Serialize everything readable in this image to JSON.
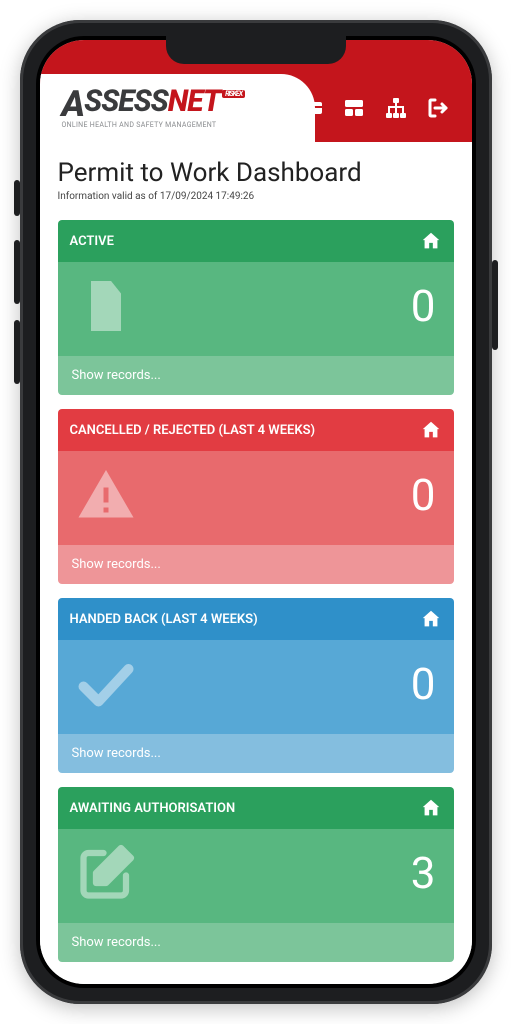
{
  "logo": {
    "text_a": "A",
    "text_ssess": "SSESS",
    "text_net": "NET",
    "riskex": "RISKEX",
    "subtitle": "ONLINE HEALTH AND SAFETY MANAGEMENT"
  },
  "header_icons": [
    "card-icon",
    "dashboard-icon",
    "sitemap-icon",
    "logout-icon"
  ],
  "page": {
    "title": "Permit to Work Dashboard",
    "subtitle": "Information valid as of 17/09/2024 17:49:26"
  },
  "cards": [
    {
      "title": "ACTIVE",
      "value": "0",
      "footer": "Show records...",
      "icon": "file-icon",
      "theme": "c-green"
    },
    {
      "title": "CANCELLED / REJECTED (LAST 4 WEEKS)",
      "value": "0",
      "footer": "Show records...",
      "icon": "alert-icon",
      "theme": "c-red"
    },
    {
      "title": "HANDED BACK (LAST 4 WEEKS)",
      "value": "0",
      "footer": "Show records...",
      "icon": "check-icon",
      "theme": "c-blue"
    },
    {
      "title": "AWAITING AUTHORISATION",
      "value": "3",
      "footer": "Show records...",
      "icon": "edit-icon",
      "theme": "c-green"
    }
  ]
}
